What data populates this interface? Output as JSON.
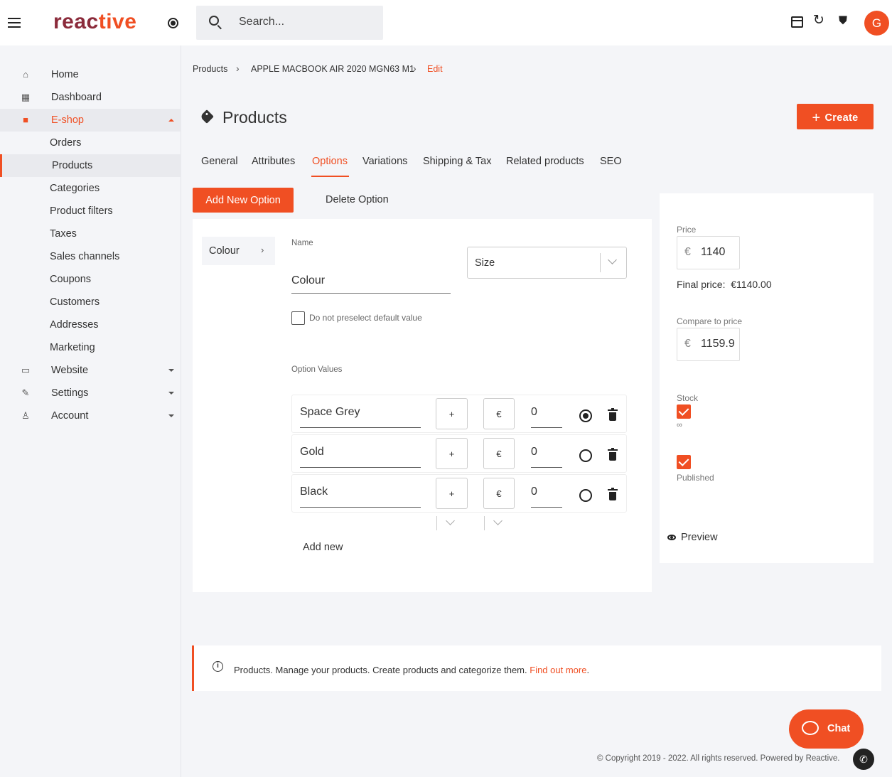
{
  "header": {
    "logo_part1": "reac",
    "logo_part2": "tiv",
    "logo_part3": "e",
    "search_placeholder": "Search...",
    "avatar_initial": "G"
  },
  "sidebar": {
    "items": [
      {
        "label": "Home",
        "icon": "home-icon"
      },
      {
        "label": "Dashboard",
        "icon": "dashboard-icon"
      },
      {
        "label": "E-shop",
        "icon": "bag-icon"
      },
      {
        "label": "Website",
        "icon": "website-icon"
      },
      {
        "label": "Settings",
        "icon": "wrench-icon"
      },
      {
        "label": "Account",
        "icon": "user-icon"
      }
    ],
    "eshop_sub": [
      {
        "label": "Orders"
      },
      {
        "label": "Products"
      },
      {
        "label": "Categories"
      },
      {
        "label": "Product filters"
      },
      {
        "label": "Taxes"
      },
      {
        "label": "Sales channels"
      },
      {
        "label": "Coupons"
      },
      {
        "label": "Customers"
      },
      {
        "label": "Addresses"
      },
      {
        "label": "Marketing"
      }
    ]
  },
  "breadcrumb": {
    "items": [
      "Products",
      "APPLE MACBOOK AIR 2020 MGN63 M1",
      "Edit"
    ]
  },
  "page": {
    "title": "Products",
    "create_label": "Create"
  },
  "tabs": [
    "General",
    "Attributes",
    "Options",
    "Variations",
    "Shipping & Tax",
    "Related products",
    "SEO"
  ],
  "option_editor": {
    "add_new_option_label": "Add New Option",
    "delete_option_label": "Delete Option",
    "option_list": [
      "Colour"
    ],
    "name_label": "Name",
    "name_value": "Colour",
    "type_select_value": "Size",
    "preselect_label": "Do not preselect default value",
    "option_values_label": "Option Values",
    "values": [
      {
        "name": "Space Grey",
        "sign": "+",
        "currency": "€",
        "price": "0",
        "default": true
      },
      {
        "name": "Gold",
        "sign": "+",
        "currency": "€",
        "price": "0",
        "default": false
      },
      {
        "name": "Black",
        "sign": "+",
        "currency": "€",
        "price": "0",
        "default": false
      }
    ],
    "add_new_label": "Add new"
  },
  "price_panel": {
    "price_label": "Price",
    "currency": "€",
    "price_value": "1140",
    "final_price_label": "Final price:",
    "final_price_value": "€1140.00",
    "compare_label": "Compare to price",
    "compare_value": "1159.9",
    "stock_label": "Stock",
    "stock_value": "∞",
    "published_label": "Published",
    "preview_label": "Preview"
  },
  "info_bar": {
    "text": "Products. Manage your products. Create products and categorize them.",
    "link": "Find out more",
    "suffix": "."
  },
  "footer": {
    "chat_label": "Chat",
    "copyright": "© Copyright 2019 - 2022. All rights reserved. Powered by Reactive."
  },
  "colors": {
    "accent": "#f04f23",
    "logo_dark": "#8b2b3b"
  }
}
